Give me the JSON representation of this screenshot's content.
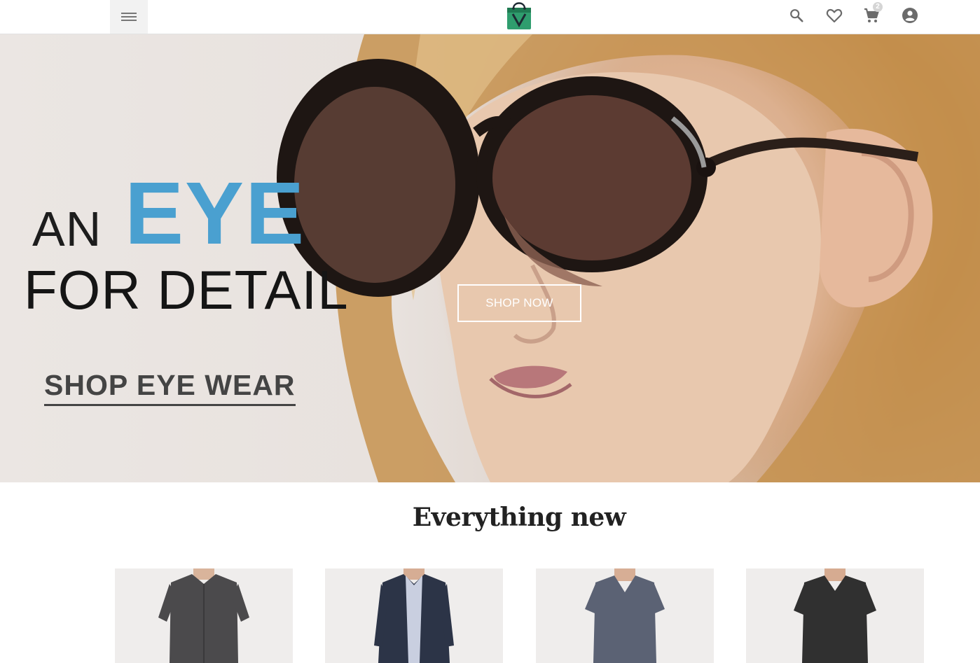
{
  "header": {
    "menu_icon": "menu-icon",
    "logo_icon": "shopping-bag-logo",
    "cart_count": "2",
    "icons": [
      "search-icon",
      "heart-icon",
      "cart-icon",
      "account-icon"
    ]
  },
  "hero": {
    "headline_line1_a": "AN",
    "headline_line1_b": "EYE",
    "headline_line2": "FOR DETAIL",
    "link_label": "SHOP EYE WEAR",
    "button_label": "SHOP NOW",
    "slides": 3,
    "active_slide": 1
  },
  "section": {
    "title": "Everything new"
  },
  "colors": {
    "accent_blue": "#4aa0d0",
    "logo_green": "#2f9d6e"
  }
}
